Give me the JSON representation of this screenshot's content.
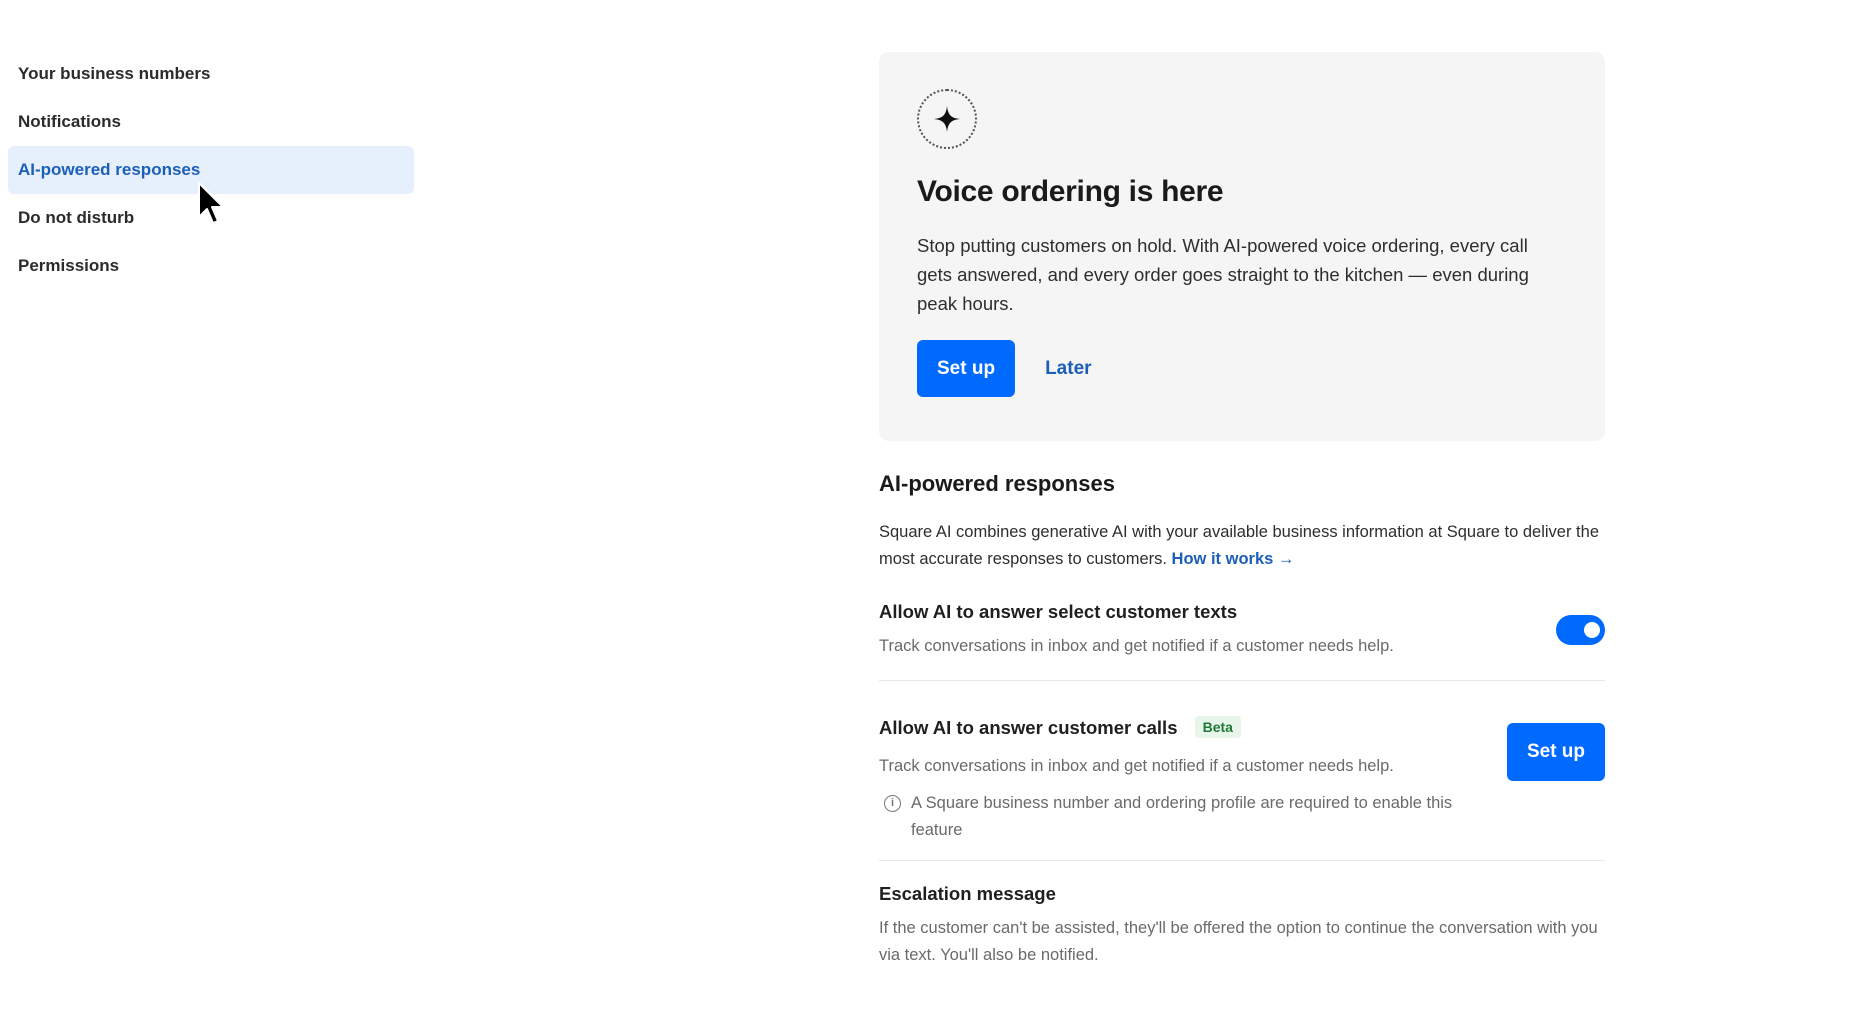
{
  "sidebar": {
    "items": [
      {
        "label": "Your business numbers"
      },
      {
        "label": "Notifications"
      },
      {
        "label": "AI-powered responses"
      },
      {
        "label": "Do not disturb"
      },
      {
        "label": "Permissions"
      }
    ],
    "active_index": 2
  },
  "promo": {
    "icon": "sparkle-icon",
    "title": "Voice ordering is here",
    "body": "Stop putting customers on hold. With AI-powered voice ordering, every call gets answered, and every order goes straight to the kitchen — even during peak hours.",
    "setup_label": "Set up",
    "later_label": "Later"
  },
  "ai_section": {
    "title": "AI-powered responses",
    "description": "Square AI combines generative AI with your available business information at Square to deliver the most accurate responses to customers.",
    "link_label": "How it works →"
  },
  "settings": {
    "texts": {
      "title": "Allow AI to answer select customer texts",
      "description": "Track conversations in inbox and get notified if a customer needs help.",
      "enabled": true
    },
    "calls": {
      "title": "Allow AI to answer customer calls",
      "badge": "Beta",
      "description": "Track conversations in inbox and get notified if a customer needs help.",
      "info": "A Square business number and ordering profile are required to enable this feature",
      "setup_label": "Set up"
    },
    "escalation": {
      "title": "Escalation message",
      "description": "If the customer can't be assisted, they'll be offered the option to continue the conversation with you via text. You'll also be notified."
    }
  },
  "colors": {
    "accent": "#006aff",
    "link": "#1c5fb8",
    "active_nav_bg": "#e6f0fc",
    "promo_bg": "#f5f5f5",
    "beta_bg": "#e8f5ea",
    "beta_text": "#1e7a36"
  }
}
